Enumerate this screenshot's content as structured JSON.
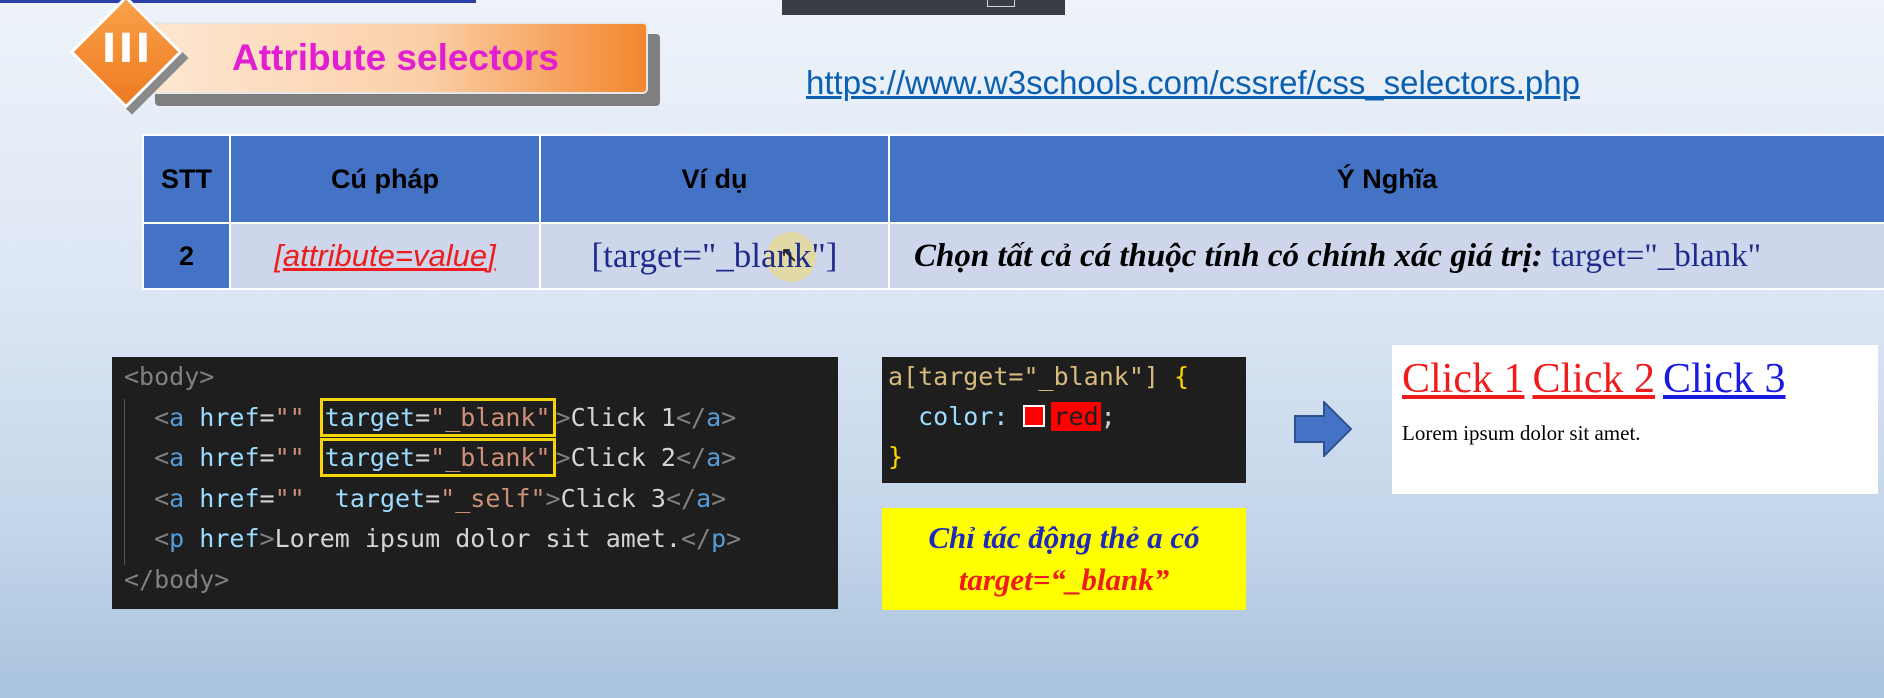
{
  "header": {
    "section_number": "III",
    "title": "Attribute selectors",
    "reference_link": "https://www.w3schools.com/cssref/css_selectors.php"
  },
  "table": {
    "headers": [
      "STT",
      "Cú pháp",
      "Ví dụ",
      "Ý Nghĩa"
    ],
    "row": {
      "stt": "2",
      "syntax_open": "[",
      "syntax_attr": "attribute",
      "syntax_eq": "=",
      "syntax_val": "value",
      "syntax_close": "]",
      "example": "[target=\"_blank\"]",
      "meaning_text": "Chọn tất cả cá thuộc tính có chính xác giá trị:",
      "meaning_code": "target=\"_blank\""
    }
  },
  "html_code": {
    "body_open": "<body>",
    "body_close": "</body>",
    "lines": [
      {
        "attr_value": "target=\"_blank\"",
        "text": "Click 1",
        "highlighted": true
      },
      {
        "attr_value": "target=\"_blank\"",
        "text": "Click 2",
        "highlighted": true
      },
      {
        "attr_value": "target=\"_self\"",
        "text": "Click 3",
        "highlighted": false
      }
    ],
    "p_text": "Lorem ipsum dolor sit amet."
  },
  "css_code": {
    "selector": "a[target=\"_blank\"]",
    "property": "color:",
    "value": "red",
    "value_color": "#ff0000"
  },
  "note": {
    "line1": "Chỉ tác động thẻ a có",
    "line2": "target=“_blank”"
  },
  "result": {
    "links": [
      {
        "text": "Click 1",
        "color": "#ee1d1d"
      },
      {
        "text": "Click 2",
        "color": "#ee1d1d"
      },
      {
        "text": "Click 3",
        "color": "#1a1ae0"
      }
    ],
    "paragraph": "Lorem ipsum dolor sit amet."
  },
  "icons": {
    "arrow": "right-arrow-icon",
    "cursor": "mouse-cursor-icon"
  }
}
